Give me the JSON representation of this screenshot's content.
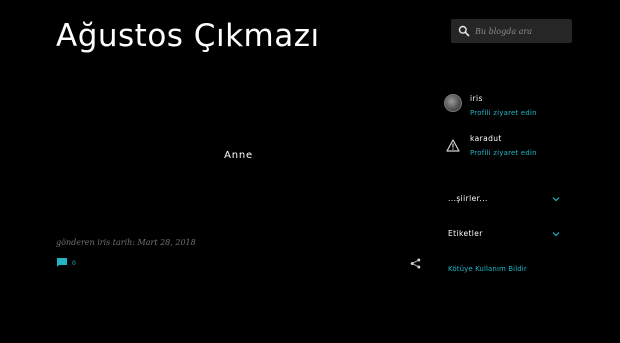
{
  "blog": {
    "title": "Ağustos Çıkmazı"
  },
  "post": {
    "body": "Anne",
    "meta": "gönderen iris tarih: Mart 28, 2018",
    "comment_count": "0"
  },
  "search": {
    "placeholder": "Bu blogda ara"
  },
  "profiles": [
    {
      "name": "iris",
      "link": "Profili ziyaret edin"
    },
    {
      "name": "karadut",
      "link": "Profili ziyaret edin"
    }
  ],
  "widgets": [
    {
      "label": "...şiirler..."
    },
    {
      "label": "Etiketler"
    }
  ],
  "report": {
    "label": "Kötüye Kullanım Bildir"
  },
  "colors": {
    "background": "#000000",
    "accent": "#21b5c4",
    "search_bg": "#262626",
    "meta_text": "#6f6f6f"
  },
  "icons": {
    "search": "search-icon",
    "comment": "comment-icon",
    "share": "share-icon",
    "warning": "warning-icon",
    "chevron": "chevron-down-icon"
  }
}
